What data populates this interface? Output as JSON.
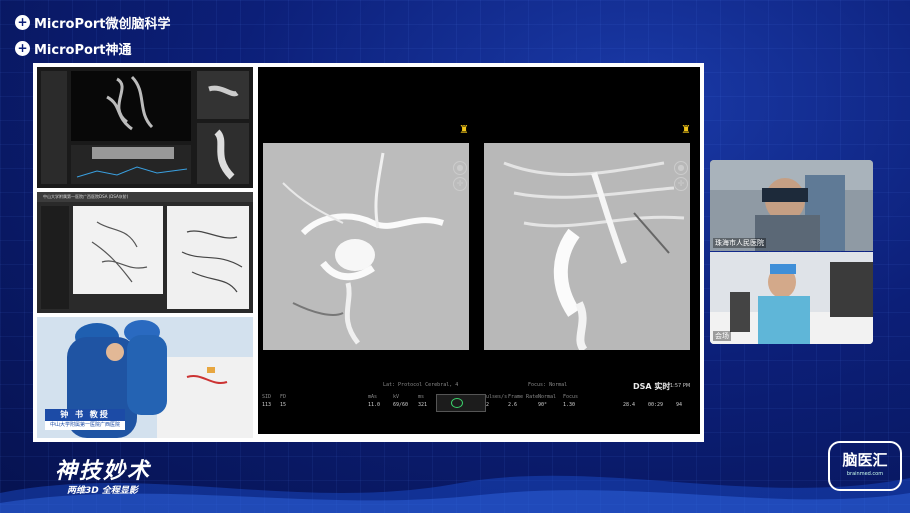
{
  "brand": {
    "line1": "MicroPort微创脑科学",
    "line2": "MicroPort神通",
    "logo_icon": "microport-logo-icon"
  },
  "thumbnails": {
    "t2_header": "中山大学附属第一医院广西医院DSA (DSA灰阶)",
    "surgeon_name": "钟 书 教授",
    "surgeon_org": "中山大学附属第一医院广西医院"
  },
  "dsa": {
    "mode_label": "DSA 实时",
    "time_label": "1:57 PM",
    "status": {
      "fields_row1": [
        "SID",
        "FD",
        "mAs",
        "kV",
        "ms",
        "Pulses/s",
        "Frame Rate",
        "Normal",
        "Focus"
      ],
      "values_row1": [
        "113",
        "15",
        "11.0",
        "69/60",
        "321",
        "72",
        "2.6",
        "90°",
        "1.30"
      ],
      "values_row2": [
        "113",
        "15",
        "11.0",
        "69/60",
        "321",
        "72",
        "2.6",
        "90°",
        "1.30",
        "28.4",
        "00:29",
        "94"
      ],
      "mid_label": "Lat: Protocol Cerebral, 4",
      "focus_label": "Focus: Normal"
    }
  },
  "cameras": {
    "cam1_label": "珠海市人民医院",
    "cam2_label": "会场"
  },
  "show": {
    "title": "神技妙术",
    "subtitle": "两维3D 全程显影"
  },
  "naoyihui": {
    "title": "脑医汇",
    "url": "brainmed.com"
  },
  "colors": {
    "bg": "#0c1f78",
    "accent_yellow": "#f0c419",
    "caption_blue": "#1c4ba6"
  }
}
